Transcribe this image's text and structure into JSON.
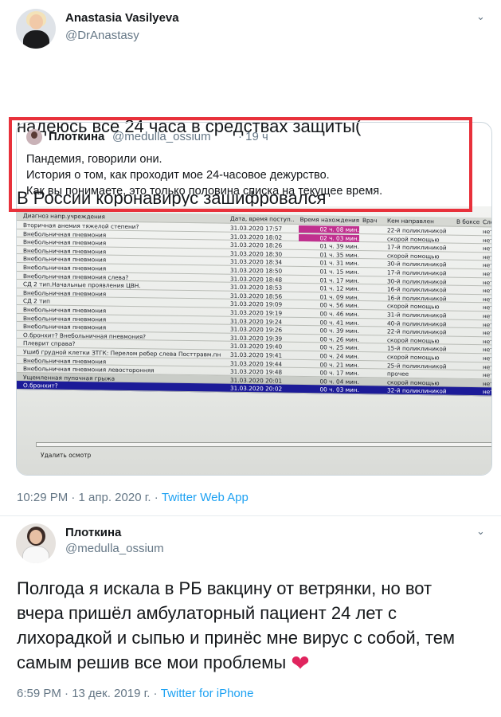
{
  "tweet1": {
    "name": "Anastasia Vasilyeva",
    "handle": "@DrAnastasy",
    "text_lines": [
      "надеюсь все 24 часа в средствах защиты(",
      "В России коронавирус зашифровался"
    ],
    "time": "10:29 PM · 1 апр. 2020 г. · ",
    "source": "Twitter Web App",
    "quote": {
      "name": "Плоткина",
      "handle": "@medulla_ossium",
      "time": "· 19 ч",
      "text_lines": [
        "Пандемия, говорили они.",
        "История о том, как проходит мое 24-часовое дежурство.",
        "Как вы понимаете, это только половина списка на текущее время."
      ],
      "photo": {
        "headers": [
          "Диагноз напр.учреждения",
          "Дата, время поступ...",
          "Время нахождения",
          "Врач",
          "Кем направлен",
          "В боксе",
          "Сле"
        ],
        "rows": [
          [
            "Вторичная анемия тяжелой степени?",
            "31.03.2020 17:57",
            "02 ч. 08 мин.",
            "",
            "22-й поликлиникой",
            "",
            "нет"
          ],
          [
            "Внебольничная пневмония",
            "31.03.2020 18:02",
            "02 ч. 03 мин.",
            "",
            "скорой помощью",
            "",
            "нет"
          ],
          [
            "Внебольничная пневмония",
            "31.03.2020 18:26",
            "01 ч. 39 мин.",
            "",
            "17-й поликлиникой",
            "",
            "нет"
          ],
          [
            "Внебольничная пневмония",
            "31.03.2020 18:30",
            "01 ч. 35 мин.",
            "",
            "скорой помощью",
            "",
            "нет"
          ],
          [
            "Внебольничная пневмония",
            "31.03.2020 18:34",
            "01 ч. 31 мин.",
            "",
            "30-й поликлиникой",
            "",
            "нет"
          ],
          [
            "Внебольничная пневмония",
            "31.03.2020 18:50",
            "01 ч. 15 мин.",
            "",
            "17-й поликлиникой",
            "",
            "нет"
          ],
          [
            "Внебольничная пневмония слева?",
            "31.03.2020 18:48",
            "01 ч. 17 мин.",
            "",
            "30-й поликлиникой",
            "",
            "нет"
          ],
          [
            "СД 2 тип.Начальные проявления ЦВН.",
            "31.03.2020 18:53",
            "01 ч. 12 мин.",
            "",
            "16-й поликлиникой",
            "",
            "нет"
          ],
          [
            "Внебольничная пневмония",
            "31.03.2020 18:56",
            "01 ч. 09 мин.",
            "",
            "16-й поликлиникой",
            "",
            "нет"
          ],
          [
            "СД 2 тип",
            "31.03.2020 19:09",
            "00 ч. 56 мин.",
            "",
            "скорой помощью",
            "",
            "нет"
          ],
          [
            "Внебольничная пневмония",
            "31.03.2020 19:19",
            "00 ч. 46 мин.",
            "",
            "31-й поликлиникой",
            "",
            "нет"
          ],
          [
            "Внебольничная пневмония",
            "31.03.2020 19:24",
            "00 ч. 41 мин.",
            "",
            "40-й поликлиникой",
            "",
            "нет"
          ],
          [
            "Внебольничная пневмония",
            "31.03.2020 19:26",
            "00 ч. 39 мин.",
            "",
            "22-й поликлиникой",
            "",
            "нет"
          ],
          [
            "О.бронхит? Внебольничная пневмония?",
            "31.03.2020 19:39",
            "00 ч. 26 мин.",
            "",
            "скорой помощью",
            "",
            "нет"
          ],
          [
            "Плеврит справа?",
            "31.03.2020 19:40",
            "00 ч. 25 мин.",
            "",
            "15-й поликлиникой",
            "",
            "нет"
          ],
          [
            "Ушиб грудной клетки ЗТГК: Перелом ребер слева Посттравм.пн",
            "31.03.2020 19:41",
            "00 ч. 24 мин.",
            "",
            "скорой помощью",
            "",
            "нет"
          ],
          [
            "Внебольничная пневмония",
            "31.03.2020 19:44",
            "00 ч. 21 мин.",
            "",
            "25-й поликлиникой",
            "",
            "нет"
          ],
          [
            "Внебольничная пневмония левосторонняя",
            "31.03.2020 19:48",
            "00 ч. 17 мин.",
            "",
            "прочее",
            "",
            "нет"
          ],
          [
            "Ущемленная пупочная грыжа",
            "31.03.2020 20:01",
            "00 ч. 04 мин.",
            "",
            "скорой помощью",
            "",
            "нет"
          ],
          [
            "О.бронхит?",
            "31.03.2020 20:02",
            "00 ч. 03 мин.",
            "",
            "32-й поликлиникой",
            "",
            "нет"
          ]
        ],
        "delete_label": "Удалить осмотр"
      }
    }
  },
  "tweet2": {
    "name": "Плоткина",
    "handle": "@medulla_ossium",
    "text_lines": [
      "Полгода я искала в РБ вакцину от ветрянки, но вот",
      "вчера пришёл амбулаторный пациент 24 лет с",
      "лихорадкой и сыпью и принёс мне вирус с собой, тем",
      "самым решив все мои проблемы"
    ],
    "heart": "❤",
    "time": "6:59 PM · 13 дек. 2019 г. · ",
    "source": "Twitter for iPhone"
  },
  "icons": {
    "chevron": "chevron-down-icon",
    "heart": "heart-icon"
  },
  "colors": {
    "link": "#1da1f2",
    "muted": "#657786",
    "highlight_box": "#e8313b",
    "heart": "#e0245e"
  }
}
